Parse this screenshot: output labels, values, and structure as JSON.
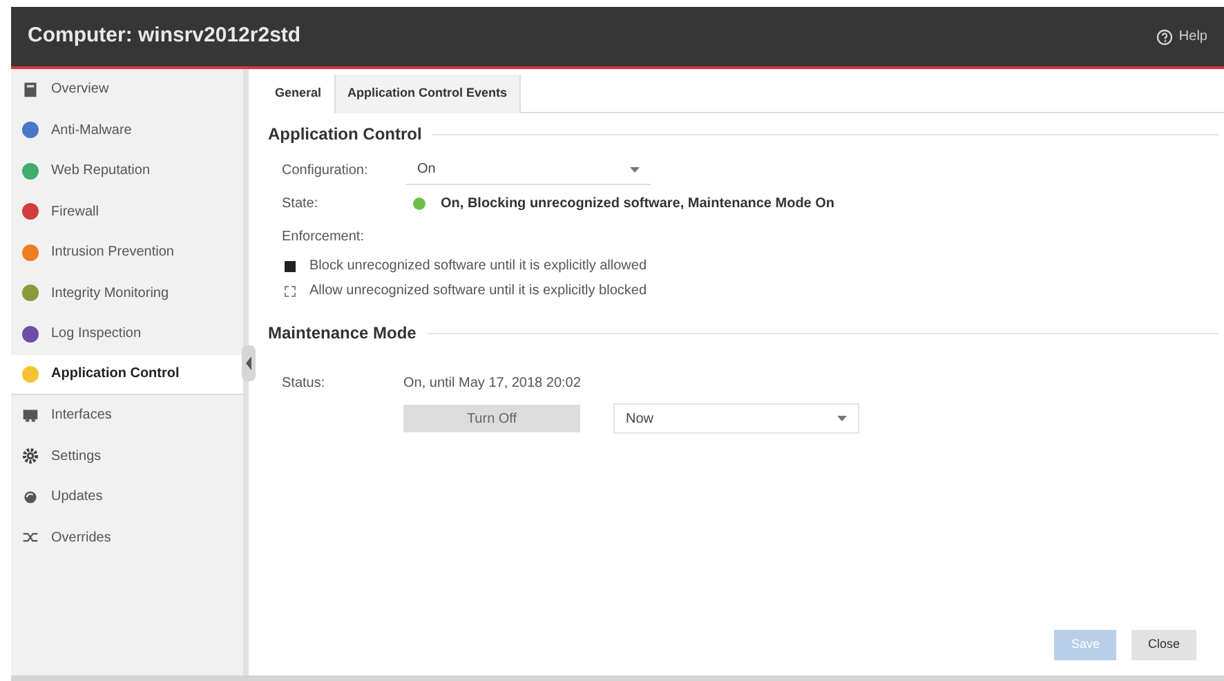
{
  "window": {
    "title": "Computer: winsrv2012r2std",
    "help": "Help"
  },
  "sidebar": {
    "items": [
      {
        "label": "Overview",
        "kind": "overview",
        "selected": false
      },
      {
        "label": "Anti-Malware",
        "kind": "module",
        "color": "#4a78c8",
        "selected": false
      },
      {
        "label": "Web Reputation",
        "kind": "module",
        "color": "#3fae6a",
        "selected": false
      },
      {
        "label": "Firewall",
        "kind": "module",
        "color": "#d23c3c",
        "selected": false
      },
      {
        "label": "Intrusion Prevention",
        "kind": "module",
        "color": "#ef7d22",
        "selected": false
      },
      {
        "label": "Integrity Monitoring",
        "kind": "module",
        "color": "#8a9a3a",
        "selected": false
      },
      {
        "label": "Log Inspection",
        "kind": "module",
        "color": "#6a4ea8",
        "selected": false
      },
      {
        "label": "Application Control",
        "kind": "module",
        "color": "#f4c430",
        "selected": true
      },
      {
        "label": "Interfaces",
        "kind": "interfaces",
        "selected": false
      },
      {
        "label": "Settings",
        "kind": "settings",
        "selected": false
      },
      {
        "label": "Updates",
        "kind": "updates",
        "selected": false
      },
      {
        "label": "Overrides",
        "kind": "overrides",
        "selected": false
      }
    ]
  },
  "tabs": [
    {
      "label": "General",
      "selected": true
    },
    {
      "label": "Application Control Events",
      "selected": false
    }
  ],
  "application_control": {
    "heading": "Application Control",
    "configuration": {
      "label": "Configuration:",
      "value": "On"
    },
    "state": {
      "label": "State:",
      "color": "#6cc04a",
      "value": "On, Blocking unrecognized software, Maintenance Mode On"
    },
    "enforcement": {
      "label": "Enforcement:",
      "options": [
        {
          "label": "Block unrecognized software until it is explicitly allowed",
          "selected": true
        },
        {
          "label": "Allow unrecognized software until it is explicitly blocked",
          "selected": false
        }
      ]
    }
  },
  "maintenance_mode": {
    "heading": "Maintenance Mode",
    "status_label": "Status:",
    "status": "On, until May 17, 2018 20:02",
    "button": "Turn Off",
    "duration": "Now"
  },
  "buttons": [
    {
      "label": "Save",
      "disabled": true
    },
    {
      "label": "Close",
      "disabled": false
    }
  ]
}
